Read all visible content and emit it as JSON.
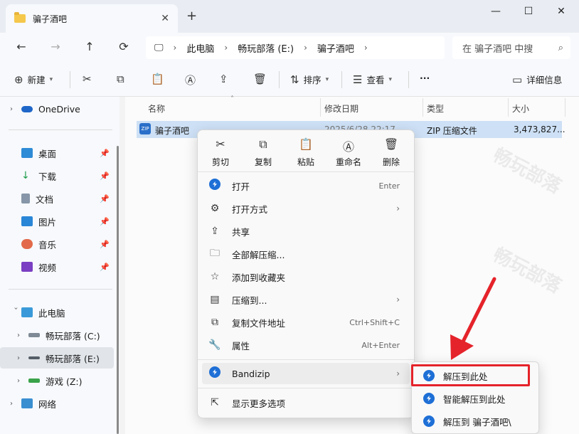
{
  "window": {
    "tab_title": "骗子酒吧",
    "new_tab": "+",
    "controls": [
      "—",
      "☐",
      "✕"
    ]
  },
  "nav": {
    "back": "←",
    "forward": "→",
    "up": "↑",
    "refresh": "⟳",
    "breadcrumb": [
      "此电脑",
      "畅玩部落 (E:)",
      "骗子酒吧"
    ],
    "search_placeholder": "在 骗子酒吧 中搜"
  },
  "toolbar": {
    "new_label": "新建",
    "sort_label": "排序",
    "view_label": "查看",
    "more_label": "···",
    "details_label": "详细信息"
  },
  "sidebar": {
    "items": [
      {
        "label": "OneDrive",
        "icon": "cloud-icon"
      },
      {
        "label": "桌面",
        "icon": "desktop-icon"
      },
      {
        "label": "下载",
        "icon": "download-icon"
      },
      {
        "label": "文档",
        "icon": "document-icon"
      },
      {
        "label": "图片",
        "icon": "picture-icon"
      },
      {
        "label": "音乐",
        "icon": "music-icon"
      },
      {
        "label": "视频",
        "icon": "video-icon"
      },
      {
        "label": "此电脑",
        "icon": "computer-icon"
      },
      {
        "label": "畅玩部落 (C:)",
        "icon": "drive-icon"
      },
      {
        "label": "畅玩部落 (E:)",
        "icon": "drive-icon"
      },
      {
        "label": "游戏 (Z:)",
        "icon": "drive-icon"
      },
      {
        "label": "网络",
        "icon": "network-icon"
      }
    ]
  },
  "columns": {
    "name": "名称",
    "modified": "修改日期",
    "type": "类型",
    "size": "大小"
  },
  "file": {
    "name": "骗子酒吧",
    "modified": "2025/6/28 22:17",
    "type": "ZIP 压缩文件",
    "size": "3,473,827..."
  },
  "context_menu": {
    "quick": [
      "剪切",
      "复制",
      "粘贴",
      "重命名",
      "删除"
    ],
    "items": [
      {
        "label": "打开",
        "shortcut": "Enter"
      },
      {
        "label": "打开方式",
        "shortcut": ""
      },
      {
        "label": "共享",
        "shortcut": ""
      },
      {
        "label": "全部解压缩...",
        "shortcut": ""
      },
      {
        "label": "添加到收藏夹",
        "shortcut": ""
      },
      {
        "label": "压缩到...",
        "shortcut": ""
      },
      {
        "label": "复制文件地址",
        "shortcut": "Ctrl+Shift+C"
      },
      {
        "label": "属性",
        "shortcut": "Alt+Enter"
      },
      {
        "label": "Bandizip",
        "shortcut": ""
      },
      {
        "label": "显示更多选项",
        "shortcut": ""
      }
    ]
  },
  "submenu": {
    "items": [
      "解压到此处",
      "智能解压到此处",
      "解压到 骗子酒吧\\"
    ]
  },
  "colors": {
    "highlight_red": "#e5232a",
    "selection_blue": "#cde0f5",
    "bandizip_blue": "#1e6fd6"
  }
}
